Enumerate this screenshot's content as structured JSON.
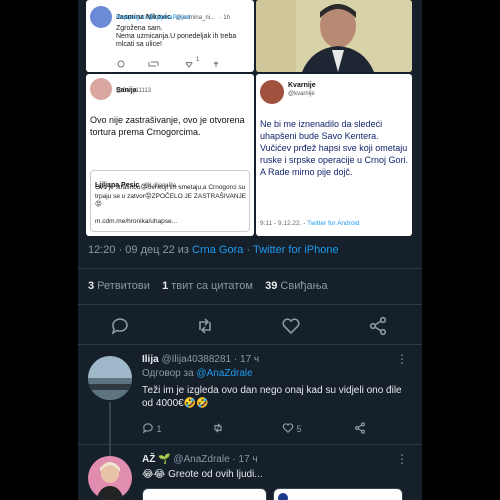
{
  "collage": {
    "card_a": {
      "author": "Jasmina Nikovic",
      "handle": "@jasmina_ni...",
      "time": "1h",
      "replying": "Replying to @LjiljanaPesic4",
      "text1": "Zgrožena sam.",
      "text2": "Nema uzmicanja.U ponedeljak ih treba",
      "text3": "mlcati sa ulice!",
      "counts": [
        "",
        "",
        "1",
        ""
      ]
    },
    "card_c": {
      "author": "Sanija",
      "handle": "@Sany11113",
      "text": "Ovo nije zastrašivanje, ovo je otvorena tortura prema Crnogorcima.",
      "quote_author": "Ljiljana Pesic",
      "quote_handle": "@LjiljanaPe...",
      "quote_text": "Ovo je strasnoo😡Svi koji im smetaju,a Crnogorci su trpaju se u zatvor😡ZPOČELO JE ZASTRAŠIVANJE😡",
      "quote_link": "m.cdm.me/hronika/uhapse..."
    },
    "card_d": {
      "author": "Kvarnije",
      "handle": "@kvarnije",
      "text": "Ne bi me iznenadilo da sledeći uhapšeni bude Savo Kentera. Vučićev prđež hapsi sve koji ometaju ruske i srpske operacije u Crnoj Gori. A Rade mirno pije dojč.",
      "meta_time": "9:11 - 9.12.22. - ",
      "meta_app": "Twitter for Android"
    }
  },
  "main_tweet": {
    "time_date": "12:20 · 09 дец 22 из ",
    "location": "Crna Gora",
    "separator": " · ",
    "client": "Twitter for iPhone"
  },
  "stats": {
    "retweets_count": "3",
    "retweets_label": " Ретвитови",
    "quotes_count": "1",
    "quotes_label": " твит са цитатом",
    "likes_count": "39",
    "likes_label": " Свиђања"
  },
  "replies": [
    {
      "name": "Ilija",
      "handle": "@Ilija40388281",
      "time": " · 17 ч",
      "reply_to_prefix": "Одговор за ",
      "reply_to": "@AnaZdrale",
      "text": "Теži im je izgleda ovo dan nego onaj kad su vidjeli ono đile od 4000€🤣🤣",
      "reply_count": "1",
      "retweet_count": "",
      "like_count": "5"
    },
    {
      "name": "AŽ",
      "emoji": "🌱",
      "handle": "@AnaZdrale",
      "time": " · 17 ч",
      "text": "😂😂 Greote od ovih ljudi..."
    }
  ],
  "colors": {
    "background": "#15202b",
    "accent": "#1d9bf0",
    "text": "#e7e9ea",
    "muted": "#8b98a5"
  }
}
